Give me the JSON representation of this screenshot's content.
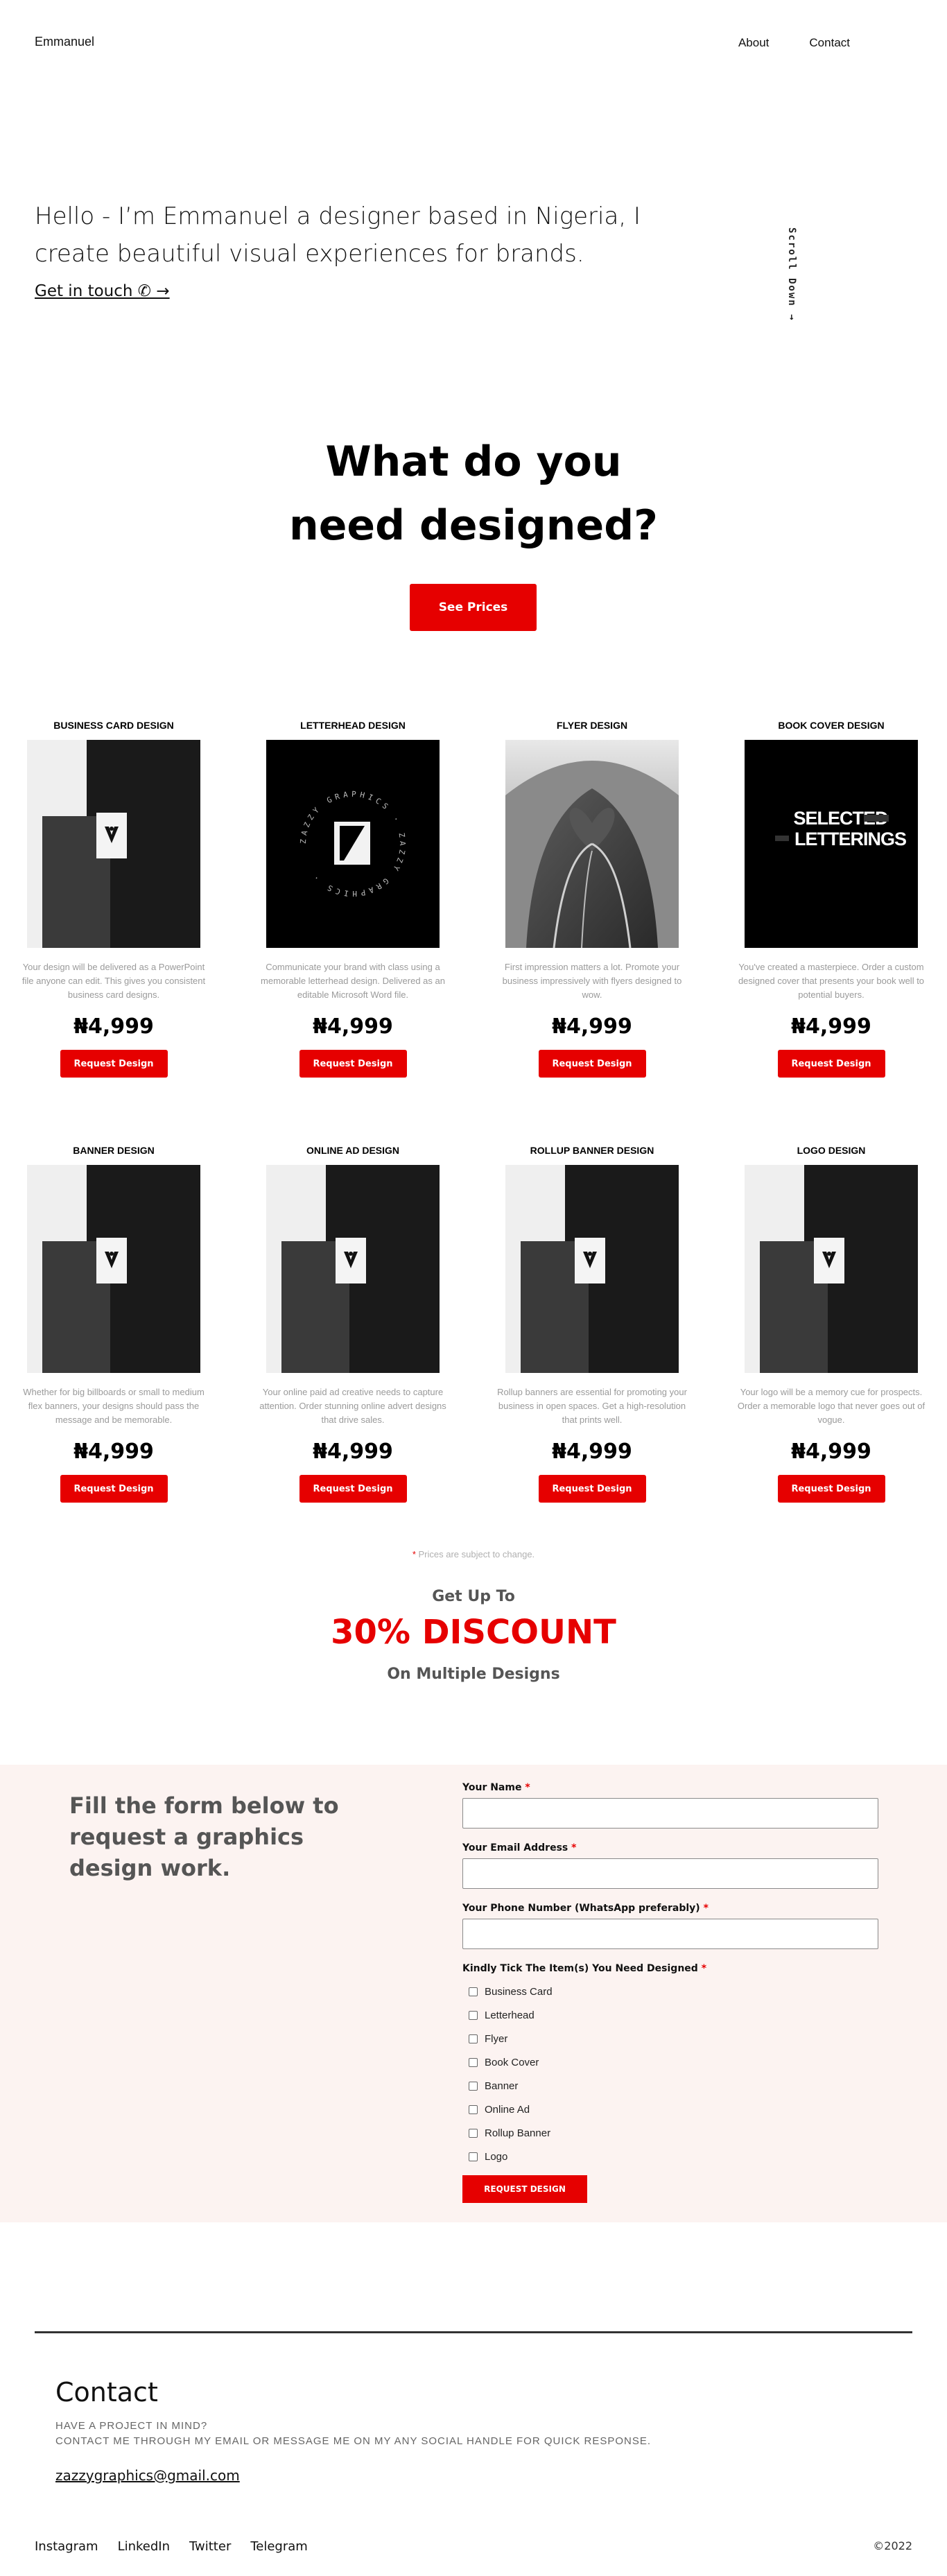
{
  "nav": {
    "brand": "Emmanuel",
    "links": [
      "About",
      "Contact"
    ]
  },
  "hero": {
    "text": "Hello - I’m Emmanuel a designer based in Nigeria, I create beautiful visual experiences for brands.",
    "cta": "Get in touch ✆ →",
    "scroll": "Scroll Down →"
  },
  "services": {
    "headline_line1": "What do you",
    "headline_line2": "need designed?",
    "see_prices": "See Prices",
    "cards": [
      {
        "title": "BUSINESS CARD DESIGN",
        "desc": "Your design will be delivered as a PowerPoint file anyone can edit. This gives you consistent business card designs.",
        "price": "₦4,999",
        "button": "Request Design"
      },
      {
        "title": "LETTERHEAD DESIGN",
        "desc": "Communicate your brand with class using a memorable letterhead design. Delivered as an editable Microsoft Word file.",
        "price": "₦4,999",
        "button": "Request Design"
      },
      {
        "title": "FLYER DESIGN",
        "desc": "First impression matters a lot. Promote your business impressively with flyers designed to wow.",
        "price": "₦4,999",
        "button": "Request Design"
      },
      {
        "title": "BOOK COVER DESIGN",
        "desc": "You've created a masterpiece. Order a custom designed cover that presents your book well to potential buyers.",
        "price": "₦4,999",
        "button": "Request Design"
      },
      {
        "title": "BANNER DESIGN",
        "desc": "Whether for big billboards or small to medium flex banners, your designs should pass the message and be memorable.",
        "price": "₦4,999",
        "button": "Request Design"
      },
      {
        "title": "ONLINE AD DESIGN",
        "desc": "Your online paid ad creative needs to capture attention. Order stunning online advert designs that drive sales.",
        "price": "₦4,999",
        "button": "Request Design"
      },
      {
        "title": "ROLLUP BANNER DESIGN",
        "desc": "Rollup banners are essential for promoting your business in open spaces. Get a high-resolution that prints well.",
        "price": "₦4,999",
        "button": "Request Design"
      },
      {
        "title": "LOGO DESIGN",
        "desc": "Your logo will be a memory cue for prospects. Order a memorable logo that never goes out of vogue.",
        "price": "₦4,999",
        "button": "Request Design"
      }
    ],
    "book_cover_art": {
      "line1": "SELECTED",
      "line2": "LETTERINGS"
    },
    "letterhead_ring": "ZAZZY GRAPHICS · ZAZZY GRAPHICS ·"
  },
  "promo": {
    "notice": "Prices are subject to change.",
    "top": "Get Up To",
    "main": "30% DISCOUNT",
    "bottom": "On Multiple Designs"
  },
  "form": {
    "intro": "Fill the form below to request a graphics design work.",
    "name_label": "Your Name",
    "email_label": "Your Email Address",
    "phone_label": "Your Phone Number (WhatsApp preferably)",
    "items_label": "Kindly Tick The Item(s) You Need Designed",
    "required_mark": "*",
    "options": [
      "Business Card",
      "Letterhead",
      "Flyer",
      "Book Cover",
      "Banner",
      "Online Ad",
      "Rollup Banner",
      "Logo"
    ],
    "submit": "REQUEST DESIGN"
  },
  "contact": {
    "title": "Contact",
    "line1": "HAVE A PROJECT IN MIND?",
    "line2": "CONTACT ME THROUGH MY EMAIL OR MESSAGE ME ON MY ANY SOCIAL HANDLE FOR QUICK RESPONSE.",
    "email": "zazzygraphics@gmail.com"
  },
  "footer": {
    "links": [
      "Instagram",
      "LinkedIn",
      "Twitter",
      "Telegram"
    ],
    "copyright": "©2022"
  },
  "colors": {
    "accent": "#e60000",
    "form_bg": "#fcf3f1"
  }
}
